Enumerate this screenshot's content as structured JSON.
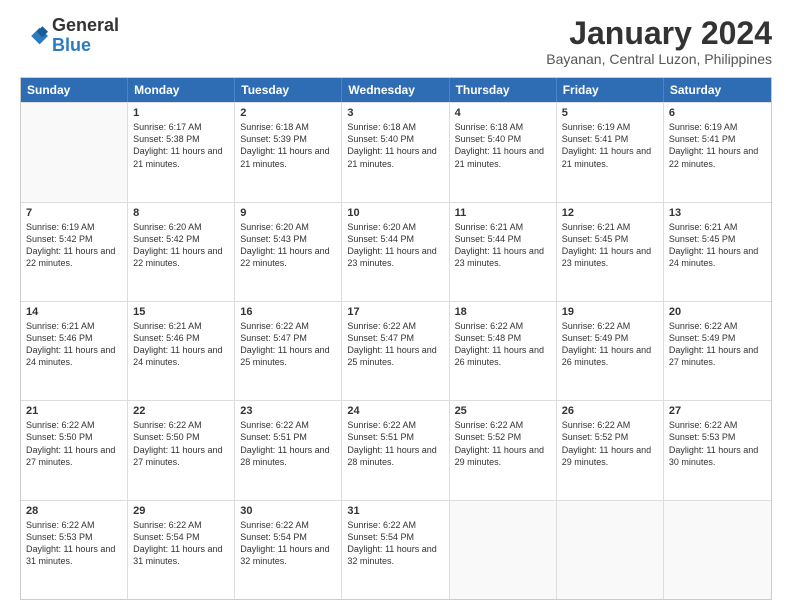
{
  "logo": {
    "general": "General",
    "blue": "Blue"
  },
  "title": {
    "main": "January 2024",
    "sub": "Bayanan, Central Luzon, Philippines"
  },
  "calendar": {
    "headers": [
      "Sunday",
      "Monday",
      "Tuesday",
      "Wednesday",
      "Thursday",
      "Friday",
      "Saturday"
    ],
    "weeks": [
      [
        {
          "day": "",
          "empty": true
        },
        {
          "day": "1",
          "sunrise": "6:17 AM",
          "sunset": "5:38 PM",
          "daylight": "11 hours and 21 minutes."
        },
        {
          "day": "2",
          "sunrise": "6:18 AM",
          "sunset": "5:39 PM",
          "daylight": "11 hours and 21 minutes."
        },
        {
          "day": "3",
          "sunrise": "6:18 AM",
          "sunset": "5:40 PM",
          "daylight": "11 hours and 21 minutes."
        },
        {
          "day": "4",
          "sunrise": "6:18 AM",
          "sunset": "5:40 PM",
          "daylight": "11 hours and 21 minutes."
        },
        {
          "day": "5",
          "sunrise": "6:19 AM",
          "sunset": "5:41 PM",
          "daylight": "11 hours and 21 minutes."
        },
        {
          "day": "6",
          "sunrise": "6:19 AM",
          "sunset": "5:41 PM",
          "daylight": "11 hours and 22 minutes."
        }
      ],
      [
        {
          "day": "7",
          "sunrise": "6:19 AM",
          "sunset": "5:42 PM",
          "daylight": "11 hours and 22 minutes."
        },
        {
          "day": "8",
          "sunrise": "6:20 AM",
          "sunset": "5:42 PM",
          "daylight": "11 hours and 22 minutes."
        },
        {
          "day": "9",
          "sunrise": "6:20 AM",
          "sunset": "5:43 PM",
          "daylight": "11 hours and 22 minutes."
        },
        {
          "day": "10",
          "sunrise": "6:20 AM",
          "sunset": "5:44 PM",
          "daylight": "11 hours and 23 minutes."
        },
        {
          "day": "11",
          "sunrise": "6:21 AM",
          "sunset": "5:44 PM",
          "daylight": "11 hours and 23 minutes."
        },
        {
          "day": "12",
          "sunrise": "6:21 AM",
          "sunset": "5:45 PM",
          "daylight": "11 hours and 23 minutes."
        },
        {
          "day": "13",
          "sunrise": "6:21 AM",
          "sunset": "5:45 PM",
          "daylight": "11 hours and 24 minutes."
        }
      ],
      [
        {
          "day": "14",
          "sunrise": "6:21 AM",
          "sunset": "5:46 PM",
          "daylight": "11 hours and 24 minutes."
        },
        {
          "day": "15",
          "sunrise": "6:21 AM",
          "sunset": "5:46 PM",
          "daylight": "11 hours and 24 minutes."
        },
        {
          "day": "16",
          "sunrise": "6:22 AM",
          "sunset": "5:47 PM",
          "daylight": "11 hours and 25 minutes."
        },
        {
          "day": "17",
          "sunrise": "6:22 AM",
          "sunset": "5:47 PM",
          "daylight": "11 hours and 25 minutes."
        },
        {
          "day": "18",
          "sunrise": "6:22 AM",
          "sunset": "5:48 PM",
          "daylight": "11 hours and 26 minutes."
        },
        {
          "day": "19",
          "sunrise": "6:22 AM",
          "sunset": "5:49 PM",
          "daylight": "11 hours and 26 minutes."
        },
        {
          "day": "20",
          "sunrise": "6:22 AM",
          "sunset": "5:49 PM",
          "daylight": "11 hours and 27 minutes."
        }
      ],
      [
        {
          "day": "21",
          "sunrise": "6:22 AM",
          "sunset": "5:50 PM",
          "daylight": "11 hours and 27 minutes."
        },
        {
          "day": "22",
          "sunrise": "6:22 AM",
          "sunset": "5:50 PM",
          "daylight": "11 hours and 27 minutes."
        },
        {
          "day": "23",
          "sunrise": "6:22 AM",
          "sunset": "5:51 PM",
          "daylight": "11 hours and 28 minutes."
        },
        {
          "day": "24",
          "sunrise": "6:22 AM",
          "sunset": "5:51 PM",
          "daylight": "11 hours and 28 minutes."
        },
        {
          "day": "25",
          "sunrise": "6:22 AM",
          "sunset": "5:52 PM",
          "daylight": "11 hours and 29 minutes."
        },
        {
          "day": "26",
          "sunrise": "6:22 AM",
          "sunset": "5:52 PM",
          "daylight": "11 hours and 29 minutes."
        },
        {
          "day": "27",
          "sunrise": "6:22 AM",
          "sunset": "5:53 PM",
          "daylight": "11 hours and 30 minutes."
        }
      ],
      [
        {
          "day": "28",
          "sunrise": "6:22 AM",
          "sunset": "5:53 PM",
          "daylight": "11 hours and 31 minutes."
        },
        {
          "day": "29",
          "sunrise": "6:22 AM",
          "sunset": "5:54 PM",
          "daylight": "11 hours and 31 minutes."
        },
        {
          "day": "30",
          "sunrise": "6:22 AM",
          "sunset": "5:54 PM",
          "daylight": "11 hours and 32 minutes."
        },
        {
          "day": "31",
          "sunrise": "6:22 AM",
          "sunset": "5:54 PM",
          "daylight": "11 hours and 32 minutes."
        },
        {
          "day": "",
          "empty": true
        },
        {
          "day": "",
          "empty": true
        },
        {
          "day": "",
          "empty": true
        }
      ]
    ]
  }
}
